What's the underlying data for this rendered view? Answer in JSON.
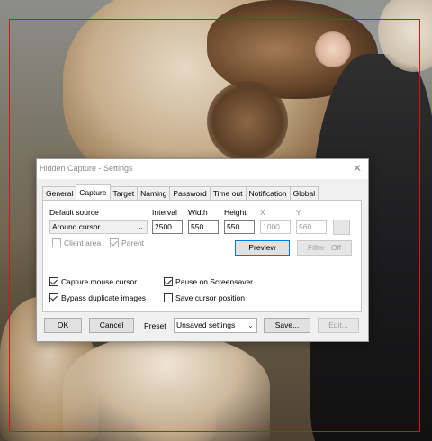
{
  "dialog": {
    "title": "Hidden Capture - Settings",
    "close_glyph": "✕"
  },
  "tabs": [
    {
      "label": "General"
    },
    {
      "label": "Capture"
    },
    {
      "label": "Target"
    },
    {
      "label": "Naming"
    },
    {
      "label": "Password"
    },
    {
      "label": "Time out"
    },
    {
      "label": "Notification"
    },
    {
      "label": "Global"
    }
  ],
  "active_tab": "Capture",
  "capture": {
    "default_source_label": "Default source",
    "default_source_value": "Around cursor",
    "interval_label": "Interval",
    "interval_value": "2500",
    "width_label": "Width",
    "width_value": "550",
    "height_label": "Height",
    "height_value": "550",
    "x_label": "X",
    "x_value": "1000",
    "y_label": "Y",
    "y_value": "560",
    "more_label": "...",
    "client_area_label": "Client area",
    "parent_label": "Parent",
    "preview_label": "Preview",
    "filter_label": "Filter : Off",
    "capture_mouse_cursor_label": "Capture mouse cursor",
    "pause_on_screensaver_label": "Pause on Screensaver",
    "bypass_duplicate_label": "Bypass duplicate images",
    "save_cursor_position_label": "Save cursor position"
  },
  "footer": {
    "ok_label": "OK",
    "cancel_label": "Cancel",
    "preset_label": "Preset",
    "preset_value": "Unsaved settings",
    "save_label": "Save...",
    "edit_label": "Edit..."
  },
  "colors": {
    "selection_border": "#e01010",
    "focus_border": "#0078d7"
  }
}
